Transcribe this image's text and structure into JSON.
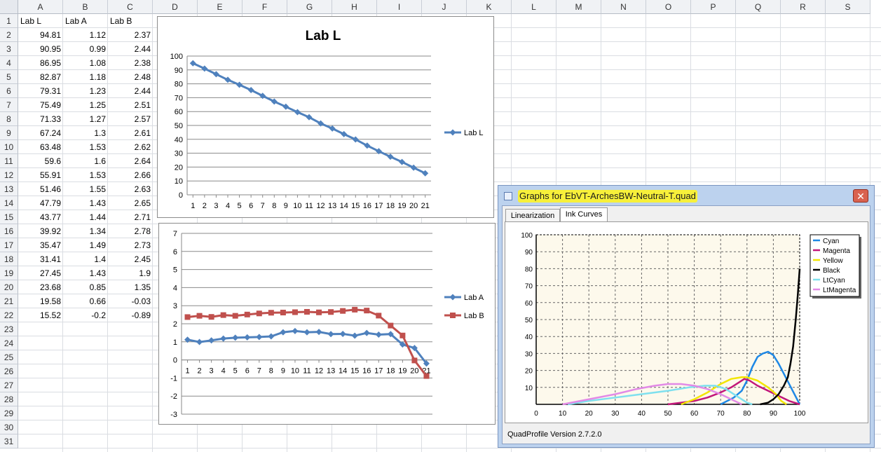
{
  "columns": [
    "A",
    "B",
    "C",
    "D",
    "E",
    "F",
    "G",
    "H",
    "I",
    "J",
    "K",
    "L",
    "M",
    "N",
    "O",
    "P",
    "Q",
    "R",
    "S"
  ],
  "rows": [
    "1",
    "2",
    "3",
    "4",
    "5",
    "6",
    "7",
    "8",
    "9",
    "10",
    "11",
    "12",
    "13",
    "14",
    "15",
    "16",
    "17",
    "18",
    "19",
    "20",
    "21",
    "22",
    "23",
    "24",
    "25",
    "26",
    "27",
    "28",
    "29",
    "30",
    "31"
  ],
  "table": {
    "headers": [
      "Lab L",
      "Lab A",
      "Lab B"
    ],
    "values": [
      [
        "94.81",
        "1.12",
        "2.37"
      ],
      [
        "90.95",
        "0.99",
        "2.44"
      ],
      [
        "86.95",
        "1.08",
        "2.38"
      ],
      [
        "82.87",
        "1.18",
        "2.48"
      ],
      [
        "79.31",
        "1.23",
        "2.44"
      ],
      [
        "75.49",
        "1.25",
        "2.51"
      ],
      [
        "71.33",
        "1.27",
        "2.57"
      ],
      [
        "67.24",
        "1.3",
        "2.61"
      ],
      [
        "63.48",
        "1.53",
        "2.62"
      ],
      [
        "59.6",
        "1.6",
        "2.64"
      ],
      [
        "55.91",
        "1.53",
        "2.66"
      ],
      [
        "51.46",
        "1.55",
        "2.63"
      ],
      [
        "47.79",
        "1.43",
        "2.65"
      ],
      [
        "43.77",
        "1.44",
        "2.71"
      ],
      [
        "39.92",
        "1.34",
        "2.78"
      ],
      [
        "35.47",
        "1.49",
        "2.73"
      ],
      [
        "31.41",
        "1.4",
        "2.45"
      ],
      [
        "27.45",
        "1.43",
        "1.9"
      ],
      [
        "23.68",
        "0.85",
        "1.35"
      ],
      [
        "19.58",
        "0.66",
        "-0.03"
      ],
      [
        "15.52",
        "-0.2",
        "-0.89"
      ]
    ]
  },
  "chart_data": [
    {
      "type": "line",
      "title": "Lab L",
      "x": [
        1,
        2,
        3,
        4,
        5,
        6,
        7,
        8,
        9,
        10,
        11,
        12,
        13,
        14,
        15,
        16,
        17,
        18,
        19,
        20,
        21
      ],
      "ylim": [
        0,
        100
      ],
      "yticks": [
        0,
        10,
        20,
        30,
        40,
        50,
        60,
        70,
        80,
        90,
        100
      ],
      "series": [
        {
          "name": "Lab L",
          "color": "#4f81bd",
          "marker": "diamond",
          "values": [
            94.81,
            90.95,
            86.95,
            82.87,
            79.31,
            75.49,
            71.33,
            67.24,
            63.48,
            59.6,
            55.91,
            51.46,
            47.79,
            43.77,
            39.92,
            35.47,
            31.41,
            27.45,
            23.68,
            19.58,
            15.52
          ]
        }
      ],
      "legend": "right",
      "grid": true
    },
    {
      "type": "line",
      "title": "",
      "x": [
        1,
        2,
        3,
        4,
        5,
        6,
        7,
        8,
        9,
        10,
        11,
        12,
        13,
        14,
        15,
        16,
        17,
        18,
        19,
        20,
        21
      ],
      "ylim": [
        -3,
        7
      ],
      "yticks": [
        -3,
        -2,
        -1,
        0,
        1,
        2,
        3,
        4,
        5,
        6,
        7
      ],
      "series": [
        {
          "name": "Lab A",
          "color": "#4f81bd",
          "marker": "diamond",
          "values": [
            1.12,
            0.99,
            1.08,
            1.18,
            1.23,
            1.25,
            1.27,
            1.3,
            1.53,
            1.6,
            1.53,
            1.55,
            1.43,
            1.44,
            1.34,
            1.49,
            1.4,
            1.43,
            0.85,
            0.66,
            -0.2
          ]
        },
        {
          "name": "Lab B",
          "color": "#c0504d",
          "marker": "square",
          "values": [
            2.37,
            2.44,
            2.38,
            2.48,
            2.44,
            2.51,
            2.57,
            2.61,
            2.62,
            2.64,
            2.66,
            2.63,
            2.65,
            2.71,
            2.78,
            2.73,
            2.45,
            1.9,
            1.35,
            -0.03,
            -0.89
          ]
        }
      ],
      "legend": "right",
      "grid": true
    },
    {
      "type": "line",
      "title": "",
      "xlim": [
        0,
        100
      ],
      "ylim": [
        0,
        100
      ],
      "xticks": [
        0,
        10,
        20,
        30,
        40,
        50,
        60,
        70,
        80,
        90,
        100
      ],
      "yticks": [
        10,
        20,
        30,
        40,
        50,
        60,
        70,
        80,
        90,
        100
      ],
      "legend": "top-right",
      "grid": true,
      "series": [
        {
          "name": "Cyan",
          "color": "#1e88e5",
          "points": [
            [
              70,
              0
            ],
            [
              75,
              4
            ],
            [
              78,
              8
            ],
            [
              80,
              14
            ],
            [
              82,
              22
            ],
            [
              84,
              28
            ],
            [
              86,
              30
            ],
            [
              88,
              31
            ],
            [
              90,
              29
            ],
            [
              92,
              24
            ],
            [
              94,
              18
            ],
            [
              96,
              12
            ],
            [
              98,
              6
            ],
            [
              100,
              0
            ]
          ]
        },
        {
          "name": "Magenta",
          "color": "#c2177a",
          "points": [
            [
              50,
              0
            ],
            [
              55,
              1
            ],
            [
              60,
              2
            ],
            [
              65,
              4
            ],
            [
              70,
              7
            ],
            [
              74,
              10
            ],
            [
              77,
              13
            ],
            [
              79,
              15
            ],
            [
              81,
              14
            ],
            [
              84,
              11
            ],
            [
              88,
              8
            ],
            [
              92,
              5
            ],
            [
              96,
              2
            ],
            [
              100,
              0
            ]
          ]
        },
        {
          "name": "Yellow",
          "color": "#f2e600",
          "points": [
            [
              55,
              0
            ],
            [
              60,
              3
            ],
            [
              65,
              7
            ],
            [
              70,
              12
            ],
            [
              74,
              15
            ],
            [
              78,
              16
            ],
            [
              80,
              16
            ],
            [
              84,
              14
            ],
            [
              88,
              10
            ],
            [
              91,
              6
            ],
            [
              93,
              2
            ],
            [
              95,
              0
            ]
          ]
        },
        {
          "name": "Black",
          "color": "#000000",
          "points": [
            [
              85,
              0
            ],
            [
              88,
              1
            ],
            [
              90,
              3
            ],
            [
              92,
              6
            ],
            [
              94,
              11
            ],
            [
              95.5,
              16
            ],
            [
              96.5,
              24
            ],
            [
              97.5,
              34
            ],
            [
              98.5,
              50
            ],
            [
              99.3,
              65
            ],
            [
              100,
              80
            ]
          ]
        },
        {
          "name": "LtCyan",
          "color": "#7fe0ee",
          "points": [
            [
              12,
              0
            ],
            [
              20,
              2
            ],
            [
              30,
              4
            ],
            [
              40,
              6
            ],
            [
              50,
              8
            ],
            [
              58,
              10
            ],
            [
              64,
              11
            ],
            [
              68,
              11
            ],
            [
              72,
              9
            ],
            [
              76,
              5
            ],
            [
              80,
              1
            ],
            [
              82,
              0
            ]
          ]
        },
        {
          "name": "LtMagenta",
          "color": "#e28ae6",
          "points": [
            [
              10,
              0
            ],
            [
              20,
              3
            ],
            [
              30,
              6
            ],
            [
              38,
              9
            ],
            [
              45,
              11
            ],
            [
              50,
              12
            ],
            [
              55,
              12
            ],
            [
              60,
              11
            ],
            [
              65,
              9
            ],
            [
              70,
              6
            ],
            [
              74,
              3
            ],
            [
              78,
              0
            ]
          ]
        }
      ]
    }
  ],
  "quadprofile": {
    "title": "Graphs for EbVT-ArchesBW-Neutral-T.quad",
    "close_label": "✕",
    "tabs": [
      "Linearization",
      "Ink Curves"
    ],
    "active_tab": "Ink Curves",
    "version": "QuadProfile Version 2.7.2.0"
  },
  "colors": {
    "series_blue": "#4f81bd",
    "series_red": "#c0504d",
    "title_highlight": "#f7f03a"
  }
}
